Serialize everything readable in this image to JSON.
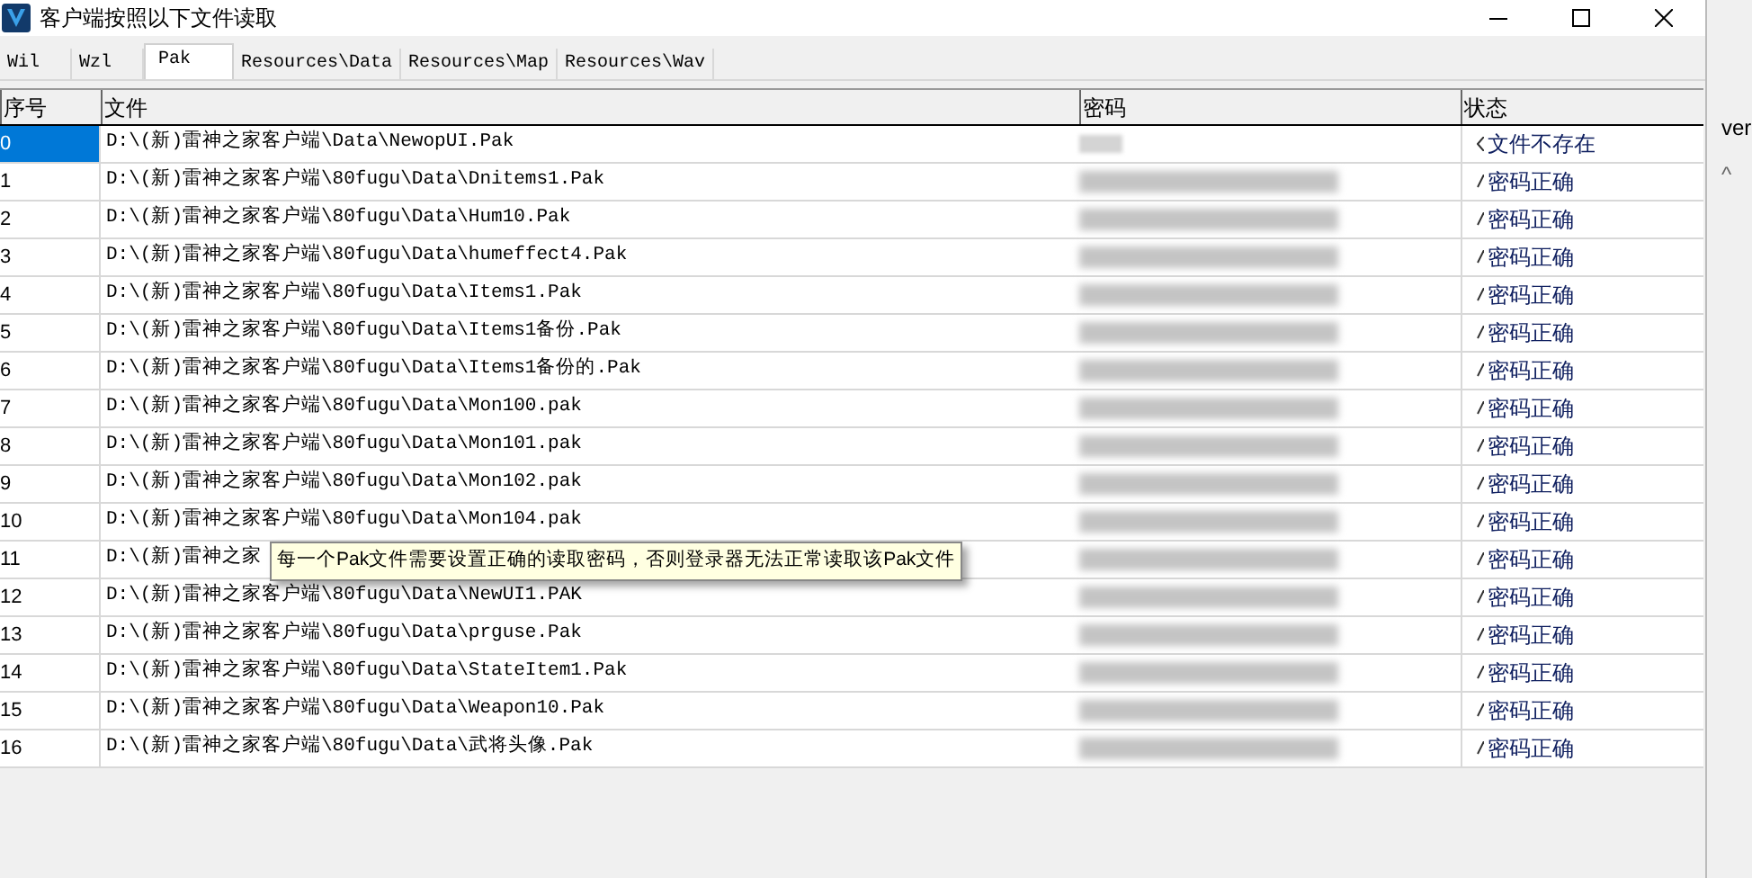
{
  "window": {
    "title": "客户端按照以下文件读取"
  },
  "tabs": [
    {
      "label": "Wil",
      "selected": false
    },
    {
      "label": "Wzl",
      "selected": false
    },
    {
      "label": "Pak",
      "selected": true
    },
    {
      "label": "Resources\\Data",
      "selected": false
    },
    {
      "label": "Resources\\Map",
      "selected": false
    },
    {
      "label": "Resources\\Wav",
      "selected": false
    }
  ],
  "table": {
    "columns": [
      "序号",
      "文件",
      "密码",
      "状态"
    ],
    "rows": [
      {
        "index": "0",
        "file": "D:\\(新)雷神之家客户端\\Data\\NewopUI.Pak",
        "status": "文件不存在",
        "kind": "missing",
        "selected": true
      },
      {
        "index": "1",
        "file": "D:\\(新)雷神之家客户端\\80fugu\\Data\\Dnitems1.Pak",
        "status": "密码正确",
        "kind": "ok",
        "selected": false
      },
      {
        "index": "2",
        "file": "D:\\(新)雷神之家客户端\\80fugu\\Data\\Hum10.Pak",
        "status": "密码正确",
        "kind": "ok",
        "selected": false
      },
      {
        "index": "3",
        "file": "D:\\(新)雷神之家客户端\\80fugu\\Data\\humeffect4.Pak",
        "status": "密码正确",
        "kind": "ok",
        "selected": false
      },
      {
        "index": "4",
        "file": "D:\\(新)雷神之家客户端\\80fugu\\Data\\Items1.Pak",
        "status": "密码正确",
        "kind": "ok",
        "selected": false
      },
      {
        "index": "5",
        "file": "D:\\(新)雷神之家客户端\\80fugu\\Data\\Items1备份.Pak",
        "status": "密码正确",
        "kind": "ok",
        "selected": false
      },
      {
        "index": "6",
        "file": "D:\\(新)雷神之家客户端\\80fugu\\Data\\Items1备份的.Pak",
        "status": "密码正确",
        "kind": "ok",
        "selected": false
      },
      {
        "index": "7",
        "file": "D:\\(新)雷神之家客户端\\80fugu\\Data\\Mon100.pak",
        "status": "密码正确",
        "kind": "ok",
        "selected": false
      },
      {
        "index": "8",
        "file": "D:\\(新)雷神之家客户端\\80fugu\\Data\\Mon101.pak",
        "status": "密码正确",
        "kind": "ok",
        "selected": false
      },
      {
        "index": "9",
        "file": "D:\\(新)雷神之家客户端\\80fugu\\Data\\Mon102.pak",
        "status": "密码正确",
        "kind": "ok",
        "selected": false
      },
      {
        "index": "10",
        "file": "D:\\(新)雷神之家客户端\\80fugu\\Data\\Mon104.pak",
        "status": "密码正确",
        "kind": "ok",
        "selected": false
      },
      {
        "index": "11",
        "file": "D:\\(新)雷神之家",
        "status": "密码正确",
        "kind": "ok",
        "selected": false
      },
      {
        "index": "12",
        "file": "D:\\(新)雷神之家客户端\\80fugu\\Data\\NewUI1.PAK",
        "status": "密码正确",
        "kind": "ok",
        "selected": false
      },
      {
        "index": "13",
        "file": "D:\\(新)雷神之家客户端\\80fugu\\Data\\prguse.Pak",
        "status": "密码正确",
        "kind": "ok",
        "selected": false
      },
      {
        "index": "14",
        "file": "D:\\(新)雷神之家客户端\\80fugu\\Data\\StateItem1.Pak",
        "status": "密码正确",
        "kind": "ok",
        "selected": false
      },
      {
        "index": "15",
        "file": "D:\\(新)雷神之家客户端\\80fugu\\Data\\Weapon10.Pak",
        "status": "密码正确",
        "kind": "ok",
        "selected": false
      },
      {
        "index": "16",
        "file": "D:\\(新)雷神之家客户端\\80fugu\\Data\\武将头像.Pak",
        "status": "密码正确",
        "kind": "ok",
        "selected": false
      }
    ]
  },
  "tooltip": {
    "text": "每一个Pak文件需要设置正确的读取密码，否则登录器无法正常读取该Pak文件"
  },
  "background_window": {
    "text": "ver",
    "caret": "^"
  }
}
